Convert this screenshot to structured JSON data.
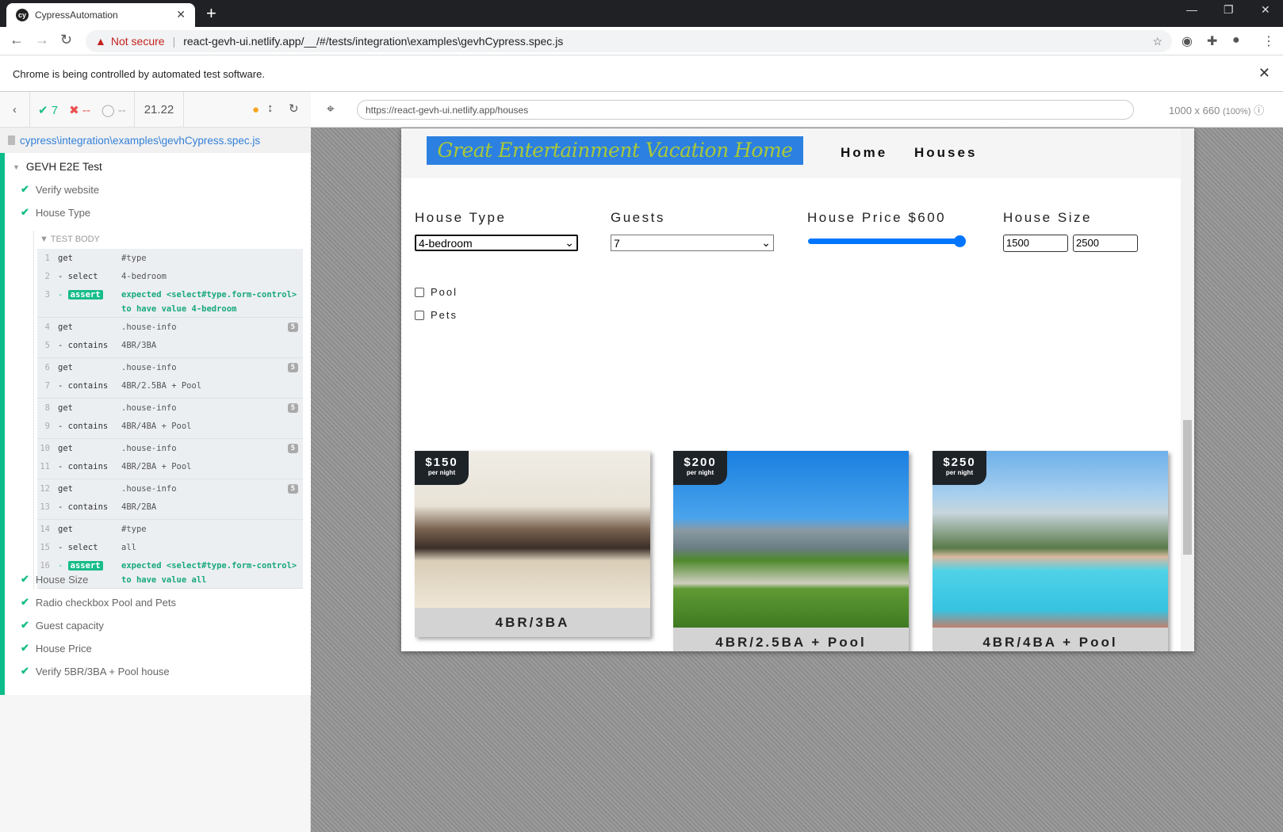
{
  "browser": {
    "tab_title": "CypressAutomation",
    "url_warning": "Not secure",
    "url": "react-gevh-ui.netlify.app/__/#/tests/integration\\examples\\gevhCypress.spec.js",
    "infobar": "Chrome is being controlled by automated test software."
  },
  "reporter": {
    "passed": "7",
    "failed": "--",
    "pending": "--",
    "duration": "21.22",
    "spec_path": "cypress\\integration\\examples\\gevhCypress.spec.js",
    "suite": "GEVH E2E Test",
    "tests_before": [
      "Verify website",
      "House Type"
    ],
    "test_body_label": "TEST BODY",
    "command_groups": [
      [
        {
          "n": "1",
          "name": "get",
          "msg": "#type"
        },
        {
          "n": "2",
          "name": "- select",
          "msg": "4-bedroom"
        },
        {
          "n": "3",
          "name": "assert",
          "msg": "expected <select#type.form-control> to have value 4-bedroom",
          "assert": true
        }
      ],
      [
        {
          "n": "4",
          "name": "get",
          "msg": ".house-info",
          "badge": "5"
        },
        {
          "n": "5",
          "name": "- contains",
          "msg": "4BR/3BA"
        }
      ],
      [
        {
          "n": "6",
          "name": "get",
          "msg": ".house-info",
          "badge": "5"
        },
        {
          "n": "7",
          "name": "- contains",
          "msg": "4BR/2.5BA + Pool"
        }
      ],
      [
        {
          "n": "8",
          "name": "get",
          "msg": ".house-info",
          "badge": "5"
        },
        {
          "n": "9",
          "name": "- contains",
          "msg": "4BR/4BA + Pool"
        }
      ],
      [
        {
          "n": "10",
          "name": "get",
          "msg": ".house-info",
          "badge": "5"
        },
        {
          "n": "11",
          "name": "- contains",
          "msg": "4BR/2BA + Pool"
        }
      ],
      [
        {
          "n": "12",
          "name": "get",
          "msg": ".house-info",
          "badge": "5"
        },
        {
          "n": "13",
          "name": "- contains",
          "msg": "4BR/2BA"
        }
      ],
      [
        {
          "n": "14",
          "name": "get",
          "msg": "#type"
        },
        {
          "n": "15",
          "name": "- select",
          "msg": "all"
        },
        {
          "n": "16",
          "name": "assert",
          "msg": "expected <select#type.form-control> to have value all",
          "assert": true
        }
      ]
    ],
    "tests_after": [
      "House Size",
      "Radio checkbox Pool and Pets",
      "Guest capacity",
      "House Price",
      "Verify 5BR/3BA + Pool house"
    ]
  },
  "aut": {
    "url": "https://react-gevh-ui.netlify.app/houses",
    "viewport": "1000 x 660",
    "zoom": "(100%)"
  },
  "site": {
    "logo": "Great Entertainment Vacation Home",
    "nav": [
      "Home",
      "Houses"
    ],
    "filters": {
      "house_type_label": "House Type",
      "house_type_value": "4-bedroom",
      "guests_label": "Guests",
      "guests_value": "7",
      "price_label": "House Price $600",
      "price_fraction": 1.0,
      "size_label": "House Size",
      "size_min": "1500",
      "size_max": "2500",
      "pool_label": "Pool",
      "pets_label": "Pets"
    },
    "houses": [
      {
        "price": "$150",
        "per": "per night",
        "title": "4BR/3BA"
      },
      {
        "price": "$200",
        "per": "per night",
        "title": "4BR/2.5BA + Pool"
      },
      {
        "price": "$250",
        "per": "per night",
        "title": "4BR/4BA + Pool"
      }
    ]
  }
}
